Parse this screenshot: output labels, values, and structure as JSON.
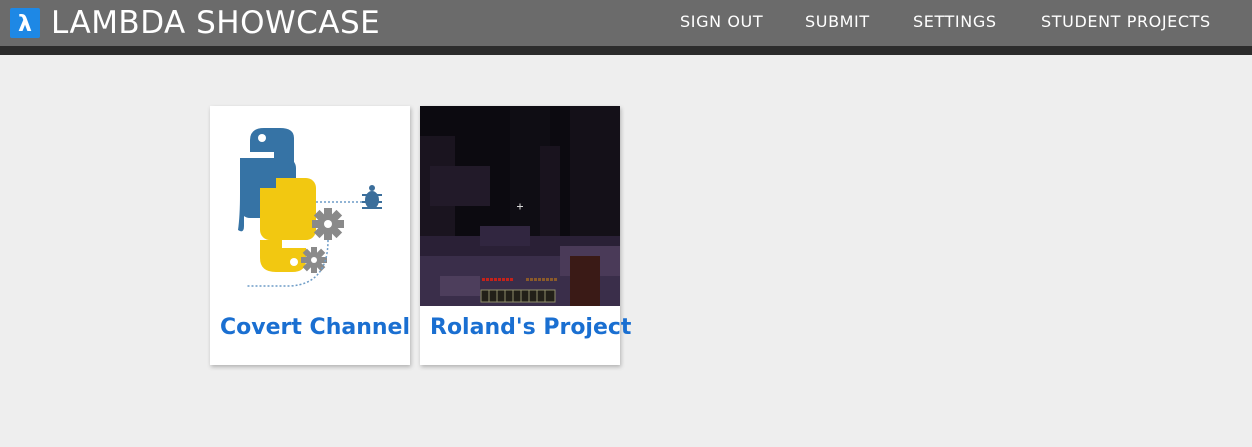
{
  "header": {
    "title": "LAMBDA SHOWCASE",
    "logo_glyph": "λ",
    "nav": {
      "sign_out": "SIGN OUT",
      "submit": "SUBMIT",
      "settings": "SETTINGS",
      "student_projects": "STUDENT PROJECTS"
    }
  },
  "projects": [
    {
      "title": "Covert Channel",
      "thumbnail": "python-logo-with-gears-icon"
    },
    {
      "title": "Roland's Project",
      "thumbnail": "dark-game-screenshot"
    }
  ],
  "colors": {
    "header_bg": "#6b6b6b",
    "page_bg": "#eeeeee",
    "link": "#1a6fd1",
    "logo_bg": "#1e88e5"
  }
}
